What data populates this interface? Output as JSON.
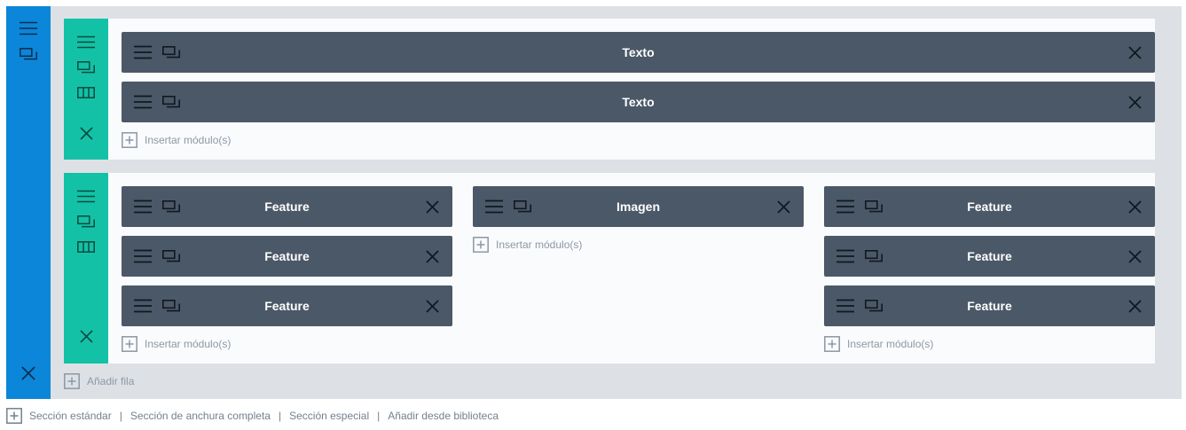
{
  "colors": {
    "section_handle": "#0c86d8",
    "row_handle": "#13c2a6",
    "module_bg": "#4b5867",
    "canvas_bg": "#dde1e6",
    "muted_text": "#8c98a5"
  },
  "icons": {
    "menu": "hamburger-icon",
    "duplicate": "duplicate-icon",
    "columns": "columns-icon",
    "close": "close-icon",
    "add": "plus-square-icon"
  },
  "rows": [
    {
      "columns": [
        {
          "modules": [
            {
              "label": "Texto"
            },
            {
              "label": "Texto"
            }
          ],
          "insert_label": "Insertar módulo(s)"
        }
      ]
    },
    {
      "columns": [
        {
          "modules": [
            {
              "label": "Feature"
            },
            {
              "label": "Feature"
            },
            {
              "label": "Feature"
            }
          ],
          "insert_label": "Insertar módulo(s)"
        },
        {
          "modules": [
            {
              "label": "Imagen"
            }
          ],
          "insert_label": "Insertar módulo(s)"
        },
        {
          "modules": [
            {
              "label": "Feature"
            },
            {
              "label": "Feature"
            },
            {
              "label": "Feature"
            }
          ],
          "insert_label": "Insertar módulo(s)"
        }
      ]
    }
  ],
  "add_row_label": "Añadir fila",
  "bottom_bar": {
    "links": [
      "Sección estándar",
      "Sección de anchura completa",
      "Sección especial",
      "Añadir desde biblioteca"
    ],
    "separator": "|"
  }
}
